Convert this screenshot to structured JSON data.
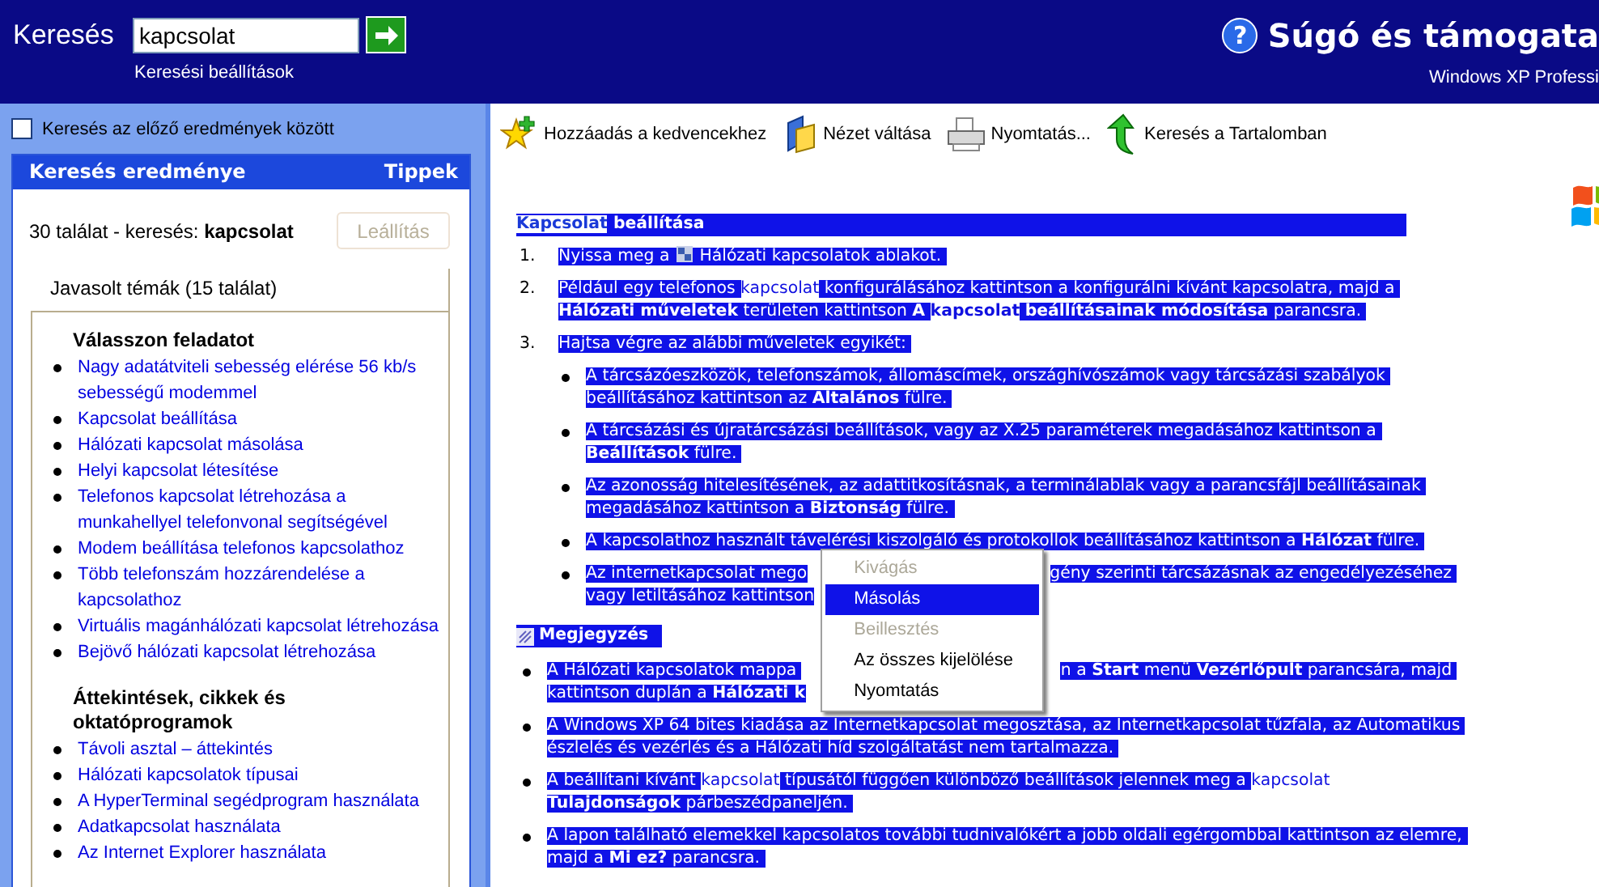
{
  "header": {
    "search_label": "Keresés",
    "search_value": "kapcsolat",
    "options_link": "Keresési beállítások",
    "help_glyph": "?",
    "title": "Súgó és támogata",
    "subtitle": "Windows XP Professi"
  },
  "left": {
    "prev_results": {
      "label": "Keresés az előző eredmények között",
      "checked": false
    },
    "results": {
      "title": "Keresés eredménye",
      "tips": "Tippek",
      "summary": "30 találat - keresés: **kapcsolat**",
      "stop_button": {
        "label": "Leállítás",
        "disabled": true
      },
      "tab": "Javasolt témák (15 találat)",
      "sections": [
        {
          "heading": "Válasszon feladatot",
          "items": [
            "Nagy adatátviteli sebesség elérése 56 kb/s sebességű modemmel",
            "Kapcsolat beállítása",
            "Hálózati kapcsolat másolása",
            "Helyi kapcsolat létesítése",
            "Telefonos kapcsolat létrehozása a munkahellyel telefonvonal segítségével",
            "Modem beállítása telefonos kapcsolathoz",
            "Több telefonszám hozzárendelése a kapcsolathoz",
            "Virtuális magánhálózati kapcsolat létrehozása",
            "Bejövő hálózati kapcsolat létrehozása"
          ]
        },
        {
          "heading": "Áttekintések, cikkek és oktatóprogramok",
          "items": [
            "Távoli asztal – áttekintés",
            "Hálózati kapcsolatok típusai",
            "A HyperTerminal segédprogram használata",
            "Adatkapcsolat használata",
            "Az Internet Explorer használata"
          ]
        }
      ]
    }
  },
  "toolbar": [
    {
      "kind": "star",
      "label": "Hozzáadás a kedvencekhez"
    },
    {
      "kind": "view",
      "label": "Nézet váltása"
    },
    {
      "kind": "printer",
      "label": "Nyomtatás..."
    },
    {
      "kind": "arrow",
      "label": "Keresés a Tartalomban"
    }
  ],
  "article": {
    "heading": [
      {
        "kind": "hit",
        "text": "Kapcsolat"
      },
      {
        "kind": "sel",
        "text": " beállítása"
      }
    ],
    "steps": [
      {
        "number": "1.",
        "lines": [
          [
            {
              "kind": "sel",
              "text": "Nyissa meg a "
            },
            {
              "kind": "icon"
            },
            {
              "kind": "sel",
              "text": " Hálózati kapcsolatok ablakot. "
            }
          ]
        ]
      },
      {
        "number": "2.",
        "lines": [
          [
            {
              "kind": "sel",
              "text": "Például egy telefonos "
            },
            {
              "kind": "hit",
              "text": "kapcsolat"
            },
            {
              "kind": "sel",
              "text": " konfigurálásához kattintson a konfigurálni kívánt kapcsolatra, majd a "
            }
          ],
          [
            {
              "kind": "sel",
              "text": "**Hálózati műveletek** területen kattintson **A** "
            },
            {
              "kind": "hit",
              "text": "**kapcsolat**"
            },
            {
              "kind": "sel",
              "text": " **beállításainak módosítása** parancsra. "
            }
          ]
        ]
      },
      {
        "number": "3.",
        "lines": [
          [
            {
              "kind": "sel",
              "text": "Hajtsa végre az alábbi műveletek egyikét: "
            }
          ]
        ],
        "bullets": [
          {
            "lines": [
              [
                {
                  "kind": "sel",
                  "text": "A tárcsázóeszközök, telefonszámok, állomáscímek, országhívószámok vagy tárcsázási szabályok "
                }
              ],
              [
                {
                  "kind": "sel",
                  "text": "beállításához kattintson az **Általános** fülre. "
                }
              ]
            ]
          },
          {
            "lines": [
              [
                {
                  "kind": "sel",
                  "text": "A tárcsázási és újratárcsázási beállítások, vagy az X.25 paraméterek megadásához kattintson a "
                }
              ],
              [
                {
                  "kind": "sel",
                  "text": "**Beállítások** fülre. "
                }
              ]
            ]
          },
          {
            "lines": [
              [
                {
                  "kind": "sel",
                  "text": "Az azonosság hitelesítésének, az adattitkosításnak, a terminálablak vagy a parancsfájl beállításainak "
                }
              ],
              [
                {
                  "kind": "sel",
                  "text": "megadásához kattintson a **Biztonság** fülre. "
                }
              ]
            ]
          },
          {
            "lines": [
              [
                {
                  "kind": "sel",
                  "text": "A kapcsolathoz használt távelérési kiszolgáló és protokollok beállításához kattintson a **Hálózat** fülre. "
                }
              ]
            ]
          },
          {
            "lines": [
              [
                {
                  "kind": "sel",
                  "text": "Az internetkapcsolat mego"
                },
                {
                  "kind": "menu"
                },
                {
                  "kind": "sel",
                  "text": "gény szerinti tárcsázásnak az engedélyezéséhez "
                }
              ],
              [
                {
                  "kind": "sel",
                  "text": "vagy letiltásához kattintson"
                }
              ]
            ]
          }
        ]
      }
    ],
    "note": {
      "title": "Megjegyzés",
      "items": [
        {
          "lines": [
            [
              {
                "kind": "sel",
                "text": "A Hálózati kapcsolatok mappa "
              },
              {
                "kind": "covered"
              },
              {
                "kind": "sel",
                "text": "n a **Start** menü **Vezérlőpult** parancsára, majd "
              }
            ],
            [
              {
                "kind": "sel",
                "text": "kattintson duplán a **Hálózati k**"
              }
            ]
          ]
        },
        {
          "lines": [
            [
              {
                "kind": "sel",
                "text": "A Windows XP 64 bites kiadása az Internetkapcsolat megosztása, az Internetkapcsolat tűzfala, az Automatikus "
              }
            ],
            [
              {
                "kind": "sel",
                "text": "észlelés és vezérlés és a Hálózati híd szolgáltatást nem tartalmazza. "
              }
            ]
          ]
        },
        {
          "lines": [
            [
              {
                "kind": "sel",
                "text": "A beállítani kívánt "
              },
              {
                "kind": "hit",
                "text": "kapcsolat"
              },
              {
                "kind": "sel",
                "text": " típusától függően különböző beállítások jelennek meg a "
              },
              {
                "kind": "hit",
                "text": "kapcsolat"
              }
            ],
            [
              {
                "kind": "sel",
                "text": "**Tulajdonságok** párbeszédpaneljén. "
              }
            ]
          ]
        },
        {
          "lines": [
            [
              {
                "kind": "sel",
                "text": "A lapon található elemekkel kapcsolatos további tudnivalókért a jobb oldali egérgombbal kattintson az elemre, "
              }
            ],
            [
              {
                "kind": "sel",
                "text": "majd a **Mi ez?** parancsra. "
              }
            ]
          ]
        }
      ]
    }
  },
  "context_menu": [
    {
      "label": "Kivágás",
      "disabled": true,
      "selected": false
    },
    {
      "label": "Másolás",
      "disabled": false,
      "selected": true
    },
    {
      "label": "Beillesztés",
      "disabled": true,
      "selected": false
    },
    {
      "label": "Az összes kijelölése",
      "disabled": false,
      "selected": false
    },
    {
      "label": "Nyomtatás",
      "disabled": false,
      "selected": false
    }
  ]
}
